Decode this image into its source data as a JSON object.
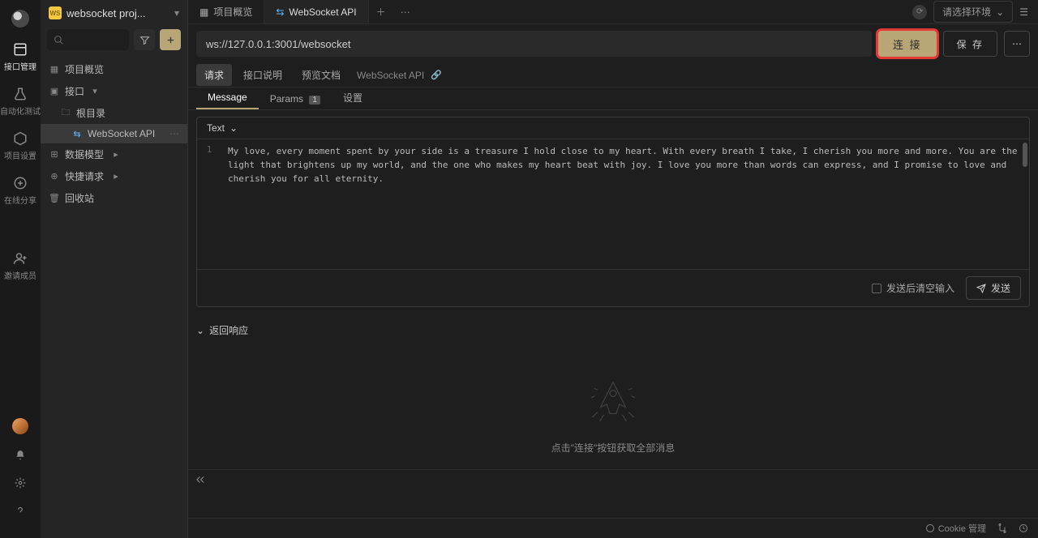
{
  "rail": {
    "items": [
      {
        "label": "接口管理"
      },
      {
        "label": "自动化测试"
      },
      {
        "label": "项目设置"
      },
      {
        "label": "在线分享"
      },
      {
        "label": "邀请成员"
      }
    ]
  },
  "project": {
    "name": "websocket proj...",
    "icon_text": "WS"
  },
  "tree": {
    "items": [
      {
        "label": "项目概览"
      },
      {
        "label": "接口"
      },
      {
        "label": "根目录"
      },
      {
        "label": "WebSocket API"
      },
      {
        "label": "数据模型"
      },
      {
        "label": "快捷请求"
      },
      {
        "label": "回收站"
      }
    ]
  },
  "tabs": [
    {
      "label": "项目概览"
    },
    {
      "label": "WebSocket API"
    }
  ],
  "env": {
    "placeholder": "请选择环境"
  },
  "url": {
    "value": "ws://127.0.0.1:3001/websocket"
  },
  "buttons": {
    "connect": "连 接",
    "save": "保 存"
  },
  "sub_tabs": {
    "request": "请求",
    "api_desc": "接口说明",
    "preview_doc": "预览文档",
    "api_name": "WebSocket API"
  },
  "msg_tabs": {
    "message": "Message",
    "params": "Params",
    "params_count": "1",
    "settings": "设置"
  },
  "editor": {
    "type_label": "Text",
    "line_no": "1",
    "content": "My love, every moment spent by your side is a treasure I hold close to my heart. With every breath I take, I cherish you more and more. You are the light that brightens up my world, and the one who makes my heart beat with joy. I love you more than words can express, and I promise to love and cherish you for all eternity."
  },
  "editor_footer": {
    "clear_after_send": "发送后清空输入",
    "send": "发送"
  },
  "response": {
    "title": "返回响应",
    "empty_hint": "点击\"连接\"按钮获取全部消息"
  },
  "status": {
    "cookie": "Cookie 管理"
  }
}
